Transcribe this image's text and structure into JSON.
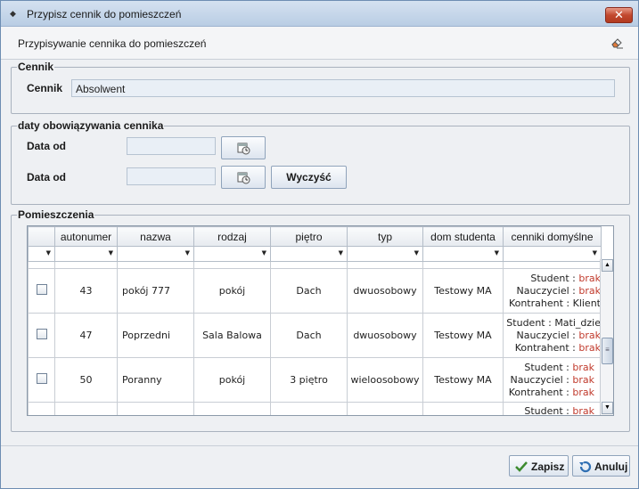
{
  "window": {
    "title": "Przypisz cennik do pomieszczeń",
    "close_label": "✕"
  },
  "header": {
    "title": "Przypisywanie cennika do pomieszczeń",
    "icon": "eraser-icon"
  },
  "cennik_group": {
    "legend": "Cennik",
    "label": "Cennik",
    "value": "Absolwent"
  },
  "dates_group": {
    "legend": "daty obowiązywania cennika",
    "row1_label": "Data od",
    "row1_value": "",
    "row2_label": "Data od",
    "row2_value": "",
    "clear_label": "Wyczyść"
  },
  "rooms_group": {
    "legend": "Pomieszczenia",
    "columns": [
      "",
      "autonumer",
      "nazwa",
      "rodzaj",
      "piętro",
      "typ",
      "dom studenta",
      "cenniki domyślne"
    ],
    "rows": [
      {
        "autonumer": "43",
        "nazwa": "pokój 777",
        "rodzaj": "pokój",
        "pietro": "Dach",
        "typ": "dwuosobowy",
        "dom": "Testowy MA",
        "cenniki": [
          {
            "k": "Student :",
            "v": "brak"
          },
          {
            "k": "Nauczyciel :",
            "v": "brak"
          },
          {
            "k": "Kontrahent :",
            "v": "Klient"
          }
        ]
      },
      {
        "autonumer": "47",
        "nazwa": "Poprzedni",
        "rodzaj": "Sala Balowa",
        "pietro": "Dach",
        "typ": "dwuosobowy",
        "dom": "Testowy MA",
        "cenniki": [
          {
            "k": "Student :",
            "v": "Mati_dzie"
          },
          {
            "k": "Nauczyciel :",
            "v": "brak"
          },
          {
            "k": "Kontrahent :",
            "v": "brak"
          }
        ]
      },
      {
        "autonumer": "50",
        "nazwa": "Poranny",
        "rodzaj": "pokój",
        "pietro": "3 piętro",
        "typ": "wieloosobowy",
        "dom": "Testowy MA",
        "cenniki": [
          {
            "k": "Student :",
            "v": "brak"
          },
          {
            "k": "Nauczyciel :",
            "v": "brak"
          },
          {
            "k": "Kontrahent :",
            "v": "brak"
          }
        ]
      },
      {
        "autonumer": "",
        "nazwa": "",
        "rodzaj": "",
        "pietro": "",
        "typ": "",
        "dom": "",
        "cenniki": [
          {
            "k": "Student :",
            "v": "brak"
          }
        ]
      }
    ]
  },
  "footer": {
    "save_label": "Zapisz",
    "cancel_label": "Anuluj"
  },
  "colors": {
    "accent_red": "#c0392b",
    "titlebar": "#b9cde4"
  }
}
